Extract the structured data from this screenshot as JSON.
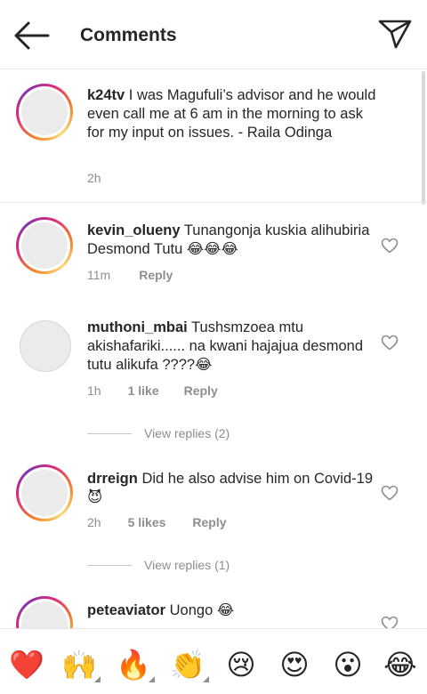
{
  "header": {
    "title": "Comments",
    "back_icon": "arrow-left-icon",
    "send_icon": "paper-plane-icon"
  },
  "caption": {
    "username": "k24tv",
    "text": "I was Magufuli’s advisor and he would even call me at 6 am in the morning to ask for my input on issues. - Raila Odinga",
    "time": "2h"
  },
  "comments": [
    {
      "username": "kevin_olueny",
      "text": "Tunangonja kuskia alihubiria Desmond Tutu 😂😂😂",
      "time": "11m",
      "likes": "",
      "reply_label": "Reply"
    },
    {
      "username": "muthoni_mbai",
      "text": "Tushsmzoea mtu akishafariki...... na kwani hajajua desmond tutu alikufa ????😂",
      "time": "1h",
      "likes": "1 like",
      "reply_label": "Reply",
      "view_replies": "View replies (2)"
    },
    {
      "username": "drreign",
      "text": "Did he also advise him on Covid-19 😈",
      "time": "2h",
      "likes": "5 likes",
      "reply_label": "Reply",
      "view_replies": "View replies (1)"
    },
    {
      "username": "peteaviator",
      "text": "Uongo 😂"
    }
  ],
  "emoji_bar": [
    "❤️",
    "🙌",
    "🔥",
    "👏",
    "😢",
    "😍",
    "😮",
    "😂"
  ],
  "colors": {
    "accent_gradient": [
      "#f58529",
      "#dd2a7b",
      "#8134af"
    ],
    "meta_gray": "#8e8e8e",
    "heart_red": "#e0245e"
  }
}
